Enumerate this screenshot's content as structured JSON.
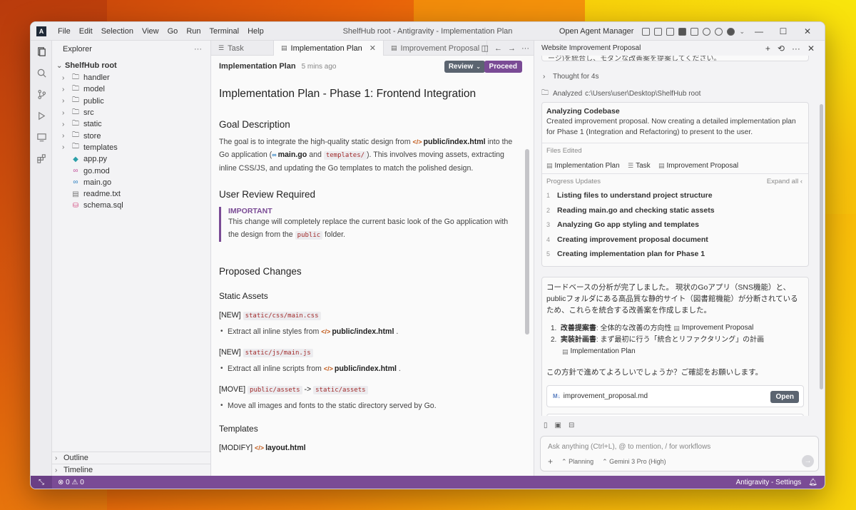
{
  "window": {
    "menu": [
      "File",
      "Edit",
      "Selection",
      "View",
      "Go",
      "Run",
      "Terminal",
      "Help"
    ],
    "title": "ShelfHub root - Antigravity - Implementation Plan",
    "agent_manager": "Open Agent Manager"
  },
  "explorer": {
    "title": "Explorer",
    "root": "ShelfHub root",
    "folders": [
      "handler",
      "model",
      "public",
      "src",
      "static",
      "store",
      "templates"
    ],
    "files": [
      "app.py",
      "go.mod",
      "main.go",
      "readme.txt",
      "schema.sql"
    ],
    "outline": "Outline",
    "timeline": "Timeline"
  },
  "editor": {
    "tabs": [
      {
        "label": "Task"
      },
      {
        "label": "Implementation Plan"
      },
      {
        "label": "Improvement Proposal"
      }
    ],
    "doc_title": "Implementation Plan",
    "doc_time": "5 mins ago",
    "review": "Review",
    "proceed": "Proceed",
    "h1": "Implementation Plan - Phase 1: Frontend Integration",
    "goal_h": "Goal Description",
    "goal_1": "The goal is to integrate the high-quality static design from",
    "goal_file1": "public/index.html",
    "goal_2": "into the Go application (",
    "goal_file2": "main.go",
    "goal_and": "and",
    "goal_code": "templates/",
    "goal_3": "). This involves moving assets, extracting inline CSS/JS, and updating the Go templates to match the polished design.",
    "review_h": "User Review Required",
    "important": "IMPORTANT",
    "imp_1": "This change will completely replace the current basic look of the Go application with the design from the",
    "imp_code": "public",
    "imp_2": "folder.",
    "changes_h": "Proposed Changes",
    "static_h": "Static Assets",
    "new_tag": "[NEW]",
    "css_path": "static/css/main.css",
    "css_b1": "Extract all inline styles from",
    "js_path": "static/js/main.js",
    "js_b1": "Extract all inline scripts from",
    "index_file": "public/index.html",
    "move_tag": "[MOVE]",
    "move_from": "public/assets",
    "move_arrow": "->",
    "move_to": "static/assets",
    "move_b1": "Move all images and fonts to the static directory served by Go.",
    "templates_h": "Templates",
    "modify_tag": "[MODIFY]",
    "layout_file": "layout.html"
  },
  "agent": {
    "title": "Website Improvement Proposal",
    "partial_top": "ージ)を統合し、モダンな改善案を提案してください。",
    "thought": "Thought for 4s",
    "analyzed": "Analyzed",
    "analyzed_path": "c:\\Users\\user\\Desktop\\ShelfHub root",
    "task_title": "Analyzing Codebase",
    "task_desc": "Created improvement proposal. Now creating a detailed implementation plan for Phase 1 (Integration and Refactoring) to present to the user.",
    "files_edited": "Files Edited",
    "edited": [
      "Implementation Plan",
      "Task",
      "Improvement Proposal"
    ],
    "progress": "Progress Updates",
    "expand": "Expand all",
    "steps": [
      {
        "n": "1",
        "t": "Listing files to understand project structure"
      },
      {
        "n": "2",
        "t": "Reading main.go and checking static assets"
      },
      {
        "n": "3",
        "t": "Analyzing Go app styling and templates"
      },
      {
        "n": "4",
        "t": "Creating improvement proposal document"
      },
      {
        "n": "5",
        "t": "Creating implementation plan for Phase 1"
      }
    ],
    "msg_1": "コードベースの分析が完了しました。 現状のGoアプリ（SNS機能）と、publicフォルダにある高品質な静的サイト（図書館機能）が分断されているため、これらを統合する改善案を作成しました。",
    "li1_b": "改善提案書",
    "li1_t": ": 全体的な改善の方向性",
    "li1_f": "Improvement Proposal",
    "li2_b": "実装計画書",
    "li2_t": ": まず最初に行う「統合とリファクタリング」の計画",
    "li2_f": "Implementation Plan",
    "msg_2": "この方針で進めてよろしいでしょうか？ご確認をお願いします。",
    "md_file": "improvement_proposal.md",
    "open": "Open",
    "placeholder": "Ask anything (Ctrl+L), @ to mention, / for workflows",
    "mode": "Planning",
    "model": "Gemini 3 Pro (High)"
  },
  "status": {
    "errors": "0",
    "warnings": "0",
    "right": "Antigravity - Settings"
  },
  "colors": {
    "accent": "#7a4b95",
    "status_bar": "#7a4b95",
    "code_text": "#a12a2a"
  }
}
